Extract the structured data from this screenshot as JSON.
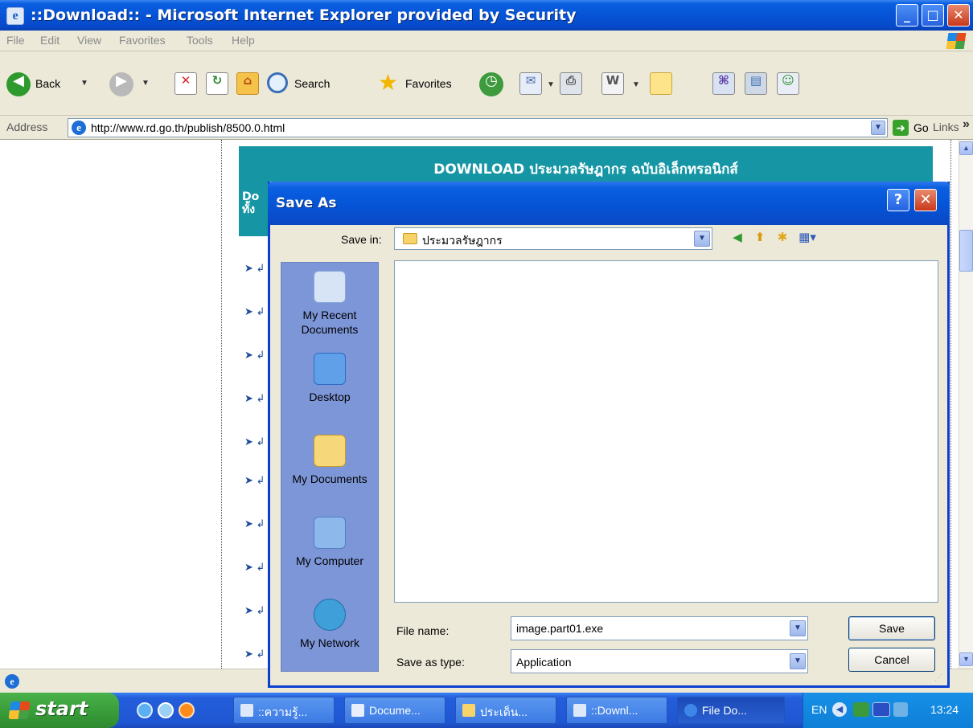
{
  "window": {
    "title": "::Download:: - Microsoft Internet Explorer provided by Security",
    "min_label": "_",
    "max_label": "□",
    "close_label": "✕"
  },
  "menu": [
    "File",
    "Edit",
    "View",
    "Favorites",
    "Tools",
    "Help"
  ],
  "toolbar": {
    "back_label": "Back",
    "search_label": "Search",
    "favorites_label": "Favorites",
    "arrow_glyph": "▼"
  },
  "address": {
    "label": "Address",
    "value": "http://www.rd.go.th/publish/8500.0.html",
    "go_label": "Go",
    "links_label": "Links",
    "links_chevron": "»"
  },
  "page": {
    "banner_title": "DOWNLOAD ประมวลรัษฎากร ฉบับอิเล็กทรอนิกส์",
    "side_header_line1": "Do",
    "side_header_line2": "ทั้ง",
    "bullet_glyph": "➤ ↲"
  },
  "dialog": {
    "title": "Save As",
    "help_label": "?",
    "close_label": "✕",
    "save_in_label": "Save in:",
    "save_in_value": "ประมวลรัษฎากร",
    "places": [
      {
        "label": "My Recent\nDocuments",
        "icon": "recent-documents-icon",
        "color": "#d7e4f6"
      },
      {
        "label": "Desktop",
        "icon": "desktop-icon",
        "color": "#5fa0e8"
      },
      {
        "label": "My Documents",
        "icon": "my-documents-icon",
        "color": "#f6d77a"
      },
      {
        "label": "My Computer",
        "icon": "my-computer-icon",
        "color": "#8cb8ec"
      },
      {
        "label": "My Network",
        "icon": "my-network-icon",
        "color": "#3f9fd8"
      }
    ],
    "file_name_label": "File name:",
    "file_name_value": "image.part01.exe",
    "save_as_type_label": "Save as type:",
    "save_as_type_value": "Application",
    "save_button": "Save",
    "cancel_button": "Cancel"
  },
  "taskbar": {
    "start_label": "start",
    "tasks": [
      {
        "label": "::ความรู้...",
        "icon_color": "#dde8f8"
      },
      {
        "label": "Docume...",
        "icon_color": "#e8eefc"
      },
      {
        "label": "ประเด็น...",
        "icon_color": "#f7d36a"
      },
      {
        "label": "::Downl...",
        "icon_color": "#dde8f8"
      },
      {
        "label": "File Do...",
        "icon_color": "#3d86e8"
      }
    ],
    "active_task_index": 4,
    "tray_lang": "EN",
    "clock": "13:24"
  },
  "colors": {
    "teal_banner": "#1696a5",
    "xp_blue": "#0654d6",
    "places_bar": "#7d96d8"
  }
}
